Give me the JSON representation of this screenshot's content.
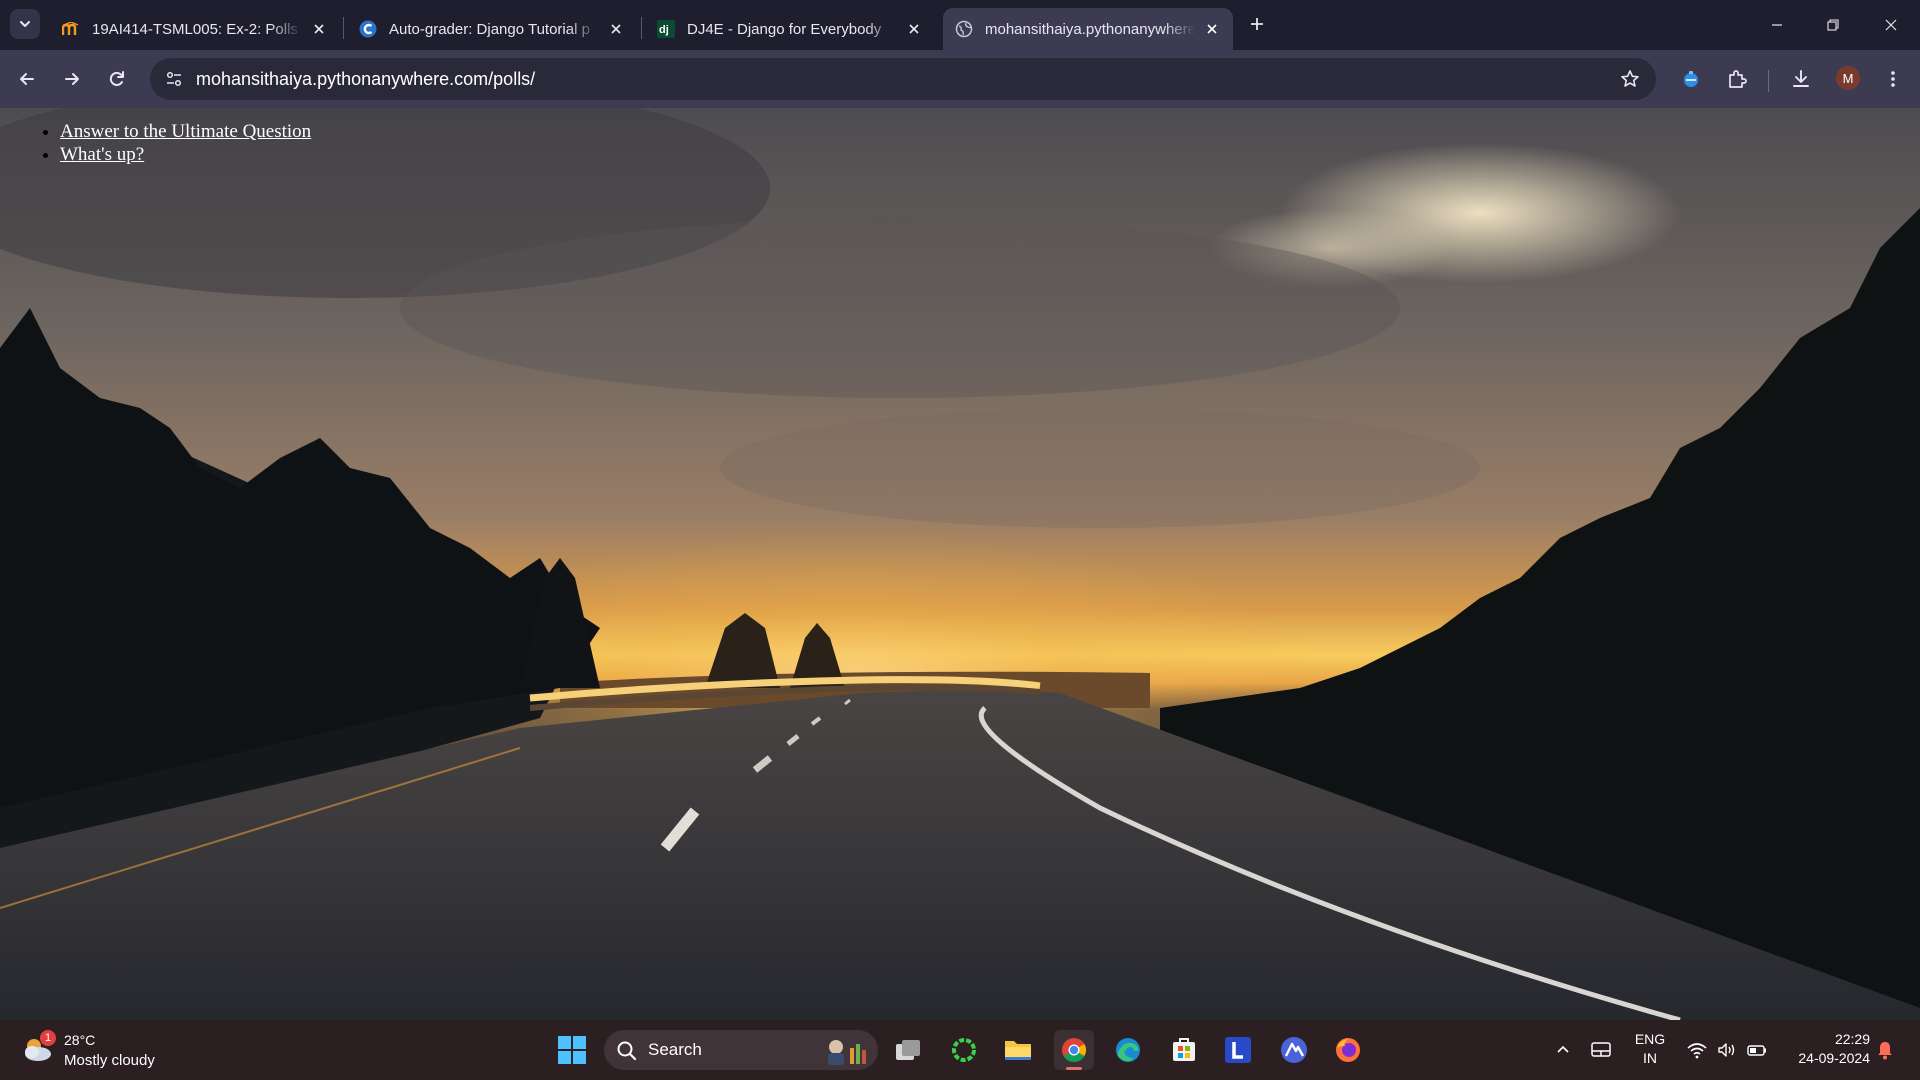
{
  "browser": {
    "tabs": [
      {
        "title": "19AI414-TSML005: Ex-2: Polls u",
        "favicon": "moodle-favicon"
      },
      {
        "title": "Auto-grader: Django Tutorial p",
        "favicon": "coursera-favicon"
      },
      {
        "title": "DJ4E - Django for Everybody",
        "favicon": "django-favicon"
      },
      {
        "title": "mohansithaiya.pythonanywhere",
        "favicon": "globe-favicon"
      }
    ],
    "active_tab": 3,
    "url": "mohansithaiya.pythonanywhere.com/polls/",
    "profile_initial": "M"
  },
  "page": {
    "polls": [
      {
        "text": "Answer to the Ultimate Question"
      },
      {
        "text": "What's up?"
      }
    ]
  },
  "taskbar": {
    "weather": {
      "badge": "1",
      "temp": "28°C",
      "condition": "Mostly cloudy"
    },
    "search_label": "Search",
    "lang_top": "ENG",
    "lang_bottom": "IN",
    "time": "22:29",
    "date": "24-09-2024"
  },
  "colors": {
    "tabstrip_bg": "#1f1e2e",
    "toolbar_bg": "#3c3b52",
    "taskbar_bg": "#2b1f22",
    "sunset_glow": "#f6c858"
  }
}
